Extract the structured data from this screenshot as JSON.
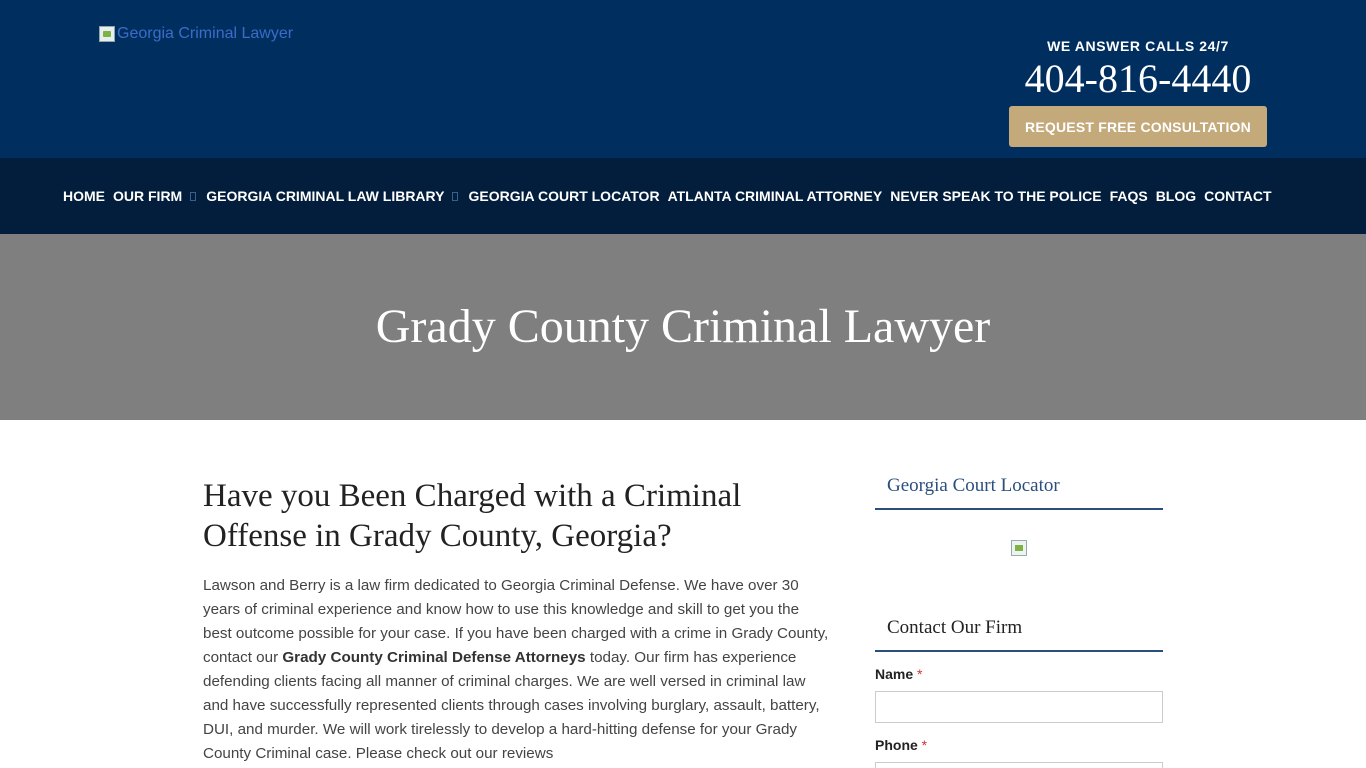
{
  "header": {
    "logo_alt": "Georgia Criminal Lawyer",
    "calls_label": "WE ANSWER CALLS 24/7",
    "phone": "404-816-4440",
    "cta_label": "REQUEST FREE CONSULTATION"
  },
  "nav": {
    "items": [
      {
        "label": "HOME"
      },
      {
        "label": "OUR FIRM"
      },
      {
        "label": "GEORGIA CRIMINAL LAW LIBRARY"
      },
      {
        "label": "GEORGIA COURT LOCATOR"
      },
      {
        "label": "ATLANTA CRIMINAL ATTORNEY"
      },
      {
        "label": "NEVER SPEAK TO THE POLICE"
      },
      {
        "label": "FAQS"
      },
      {
        "label": "BLOG"
      },
      {
        "label": "CONTACT"
      }
    ]
  },
  "hero": {
    "title": "Grady County Criminal Lawyer"
  },
  "main": {
    "heading": "Have you Been Charged with a Criminal Offense in Grady County, Georgia?",
    "paragraph_before": "Lawson and Berry is a law firm dedicated to Georgia Criminal Defense. We have over 30 years of criminal experience and know how to use this knowledge and skill to get you the best outcome possible for your case. If you have been charged with a crime in Grady County, contact our ",
    "paragraph_bold": "Grady County Criminal Defense Attorneys",
    "paragraph_after": " today. Our firm has experience defending clients facing all manner of criminal charges. We are well versed in criminal law and have successfully represented clients through cases involving burglary, assault, battery, DUI, and murder. We will work tirelessly to develop a hard-hitting defense for your Grady County Criminal case. Please check out our reviews"
  },
  "sidebar": {
    "locator_title": "Georgia Court Locator",
    "contact_title": "Contact Our Firm",
    "name_label": "Name",
    "phone_label": "Phone",
    "required_mark": "*"
  },
  "colors": {
    "header_bg": "#002f5f",
    "nav_bg": "#021e3c",
    "hero_bg": "#7f7f7f",
    "cta_bg": "#c4a97a",
    "accent": "#2b4e7e"
  }
}
